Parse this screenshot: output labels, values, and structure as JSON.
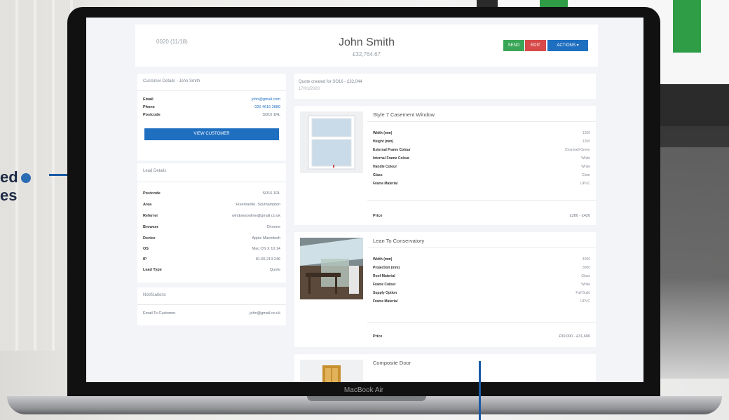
{
  "callout": {
    "line1": "ed",
    "line2": "es"
  },
  "laptop": {
    "model": "MacBook Air"
  },
  "header": {
    "quote_id": "0020 (11/18)",
    "customer_name": "John Smith",
    "customer_total": "£32,764.67",
    "buttons": {
      "green": "SEND",
      "red": "EDIT",
      "blue": "ACTIONS ▾"
    }
  },
  "customer_card": {
    "title": "Customer Details - John Smith",
    "rows": [
      {
        "k": "Email",
        "v": "john@gmail.com"
      },
      {
        "k": "Phone",
        "v": "020 4616 2880"
      },
      {
        "k": "Postcode",
        "v": "SO16 1RL"
      }
    ],
    "view_button": "VIEW CUSTOMER"
  },
  "lead_card": {
    "title": "Lead Details",
    "rows": [
      {
        "k": "Postcode",
        "v": "SO16 1RL"
      },
      {
        "k": "Area",
        "v": "Freemantle, Southampton"
      },
      {
        "k": "Referrer",
        "v": "windowsonline@gmail.co.uk"
      },
      {
        "k": "Browser",
        "v": "Chrome"
      },
      {
        "k": "Device",
        "v": "Apple Macintosh"
      },
      {
        "k": "OS",
        "v": "Mac OS X 10.14"
      },
      {
        "k": "IP",
        "v": "81.65.213.246"
      },
      {
        "k": "Lead Type",
        "v": "Quote"
      }
    ]
  },
  "notifications_card": {
    "title": "Notifications",
    "rows": [
      {
        "k": "Email To Customer",
        "v": "john@gmail.co.uk"
      }
    ]
  },
  "summary": {
    "line1": "Quote created for SO16 - £32,044",
    "line2": "17/01/2020"
  },
  "products": [
    {
      "title": "Style 7 Casement Window",
      "specs": [
        {
          "k": "Width (mm)",
          "v": "1200"
        },
        {
          "k": "Height (mm)",
          "v": "1200"
        },
        {
          "k": "External Frame Colour",
          "v": "Chartwell Green"
        },
        {
          "k": "Internal Frame Colour",
          "v": "White"
        },
        {
          "k": "Handle Colour",
          "v": "White"
        },
        {
          "k": "Glass",
          "v": "Clear"
        },
        {
          "k": "Frame Material",
          "v": "UPVC"
        }
      ],
      "price_label": "Price",
      "price_value": "£280 - £420"
    },
    {
      "title": "Lean To Conservatory",
      "specs": [
        {
          "k": "Width (mm)",
          "v": "4000"
        },
        {
          "k": "Projection (mm)",
          "v": "3000"
        },
        {
          "k": "Roof Material",
          "v": "Glass"
        },
        {
          "k": "Frame Colour",
          "v": "White"
        },
        {
          "k": "Supply Option",
          "v": "Full Build"
        },
        {
          "k": "Frame Material",
          "v": "UPVC"
        }
      ],
      "price_label": "Price",
      "price_value": "£30,000 - £31,600"
    },
    {
      "title": "Composite Door"
    }
  ]
}
